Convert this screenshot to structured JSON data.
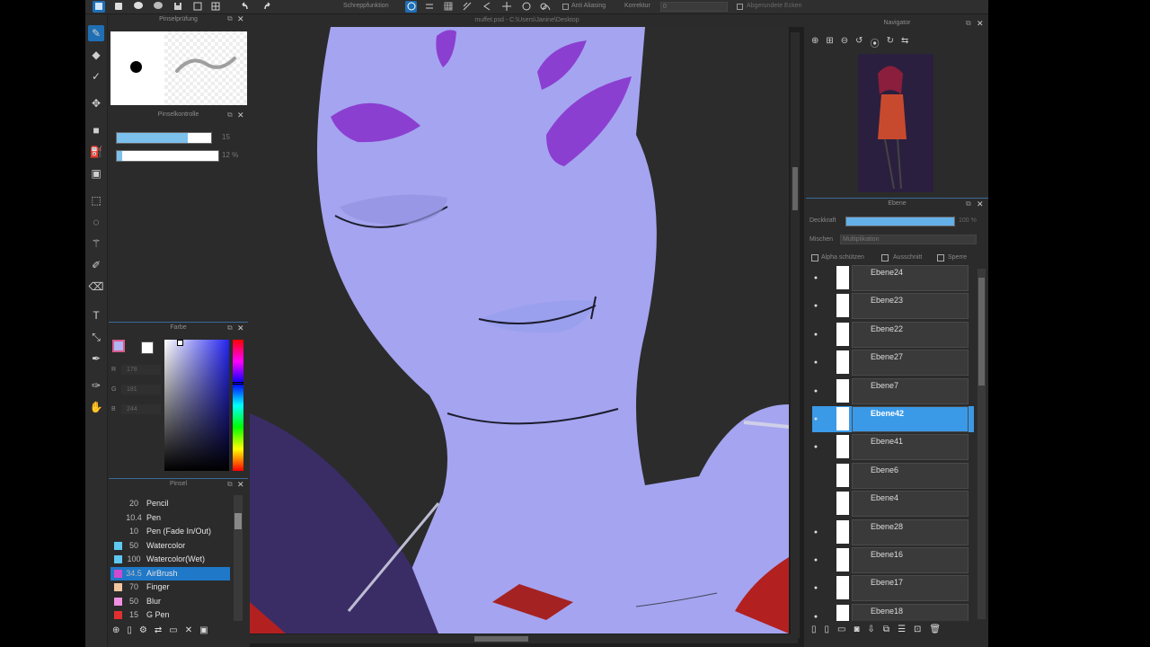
{
  "topbar": {
    "menu_label": "Schreppfunktion",
    "anti_alias_label": "Anti Aliasing",
    "korrektur_label": "Korrektur",
    "korrektur_value": "0",
    "right_label": "Abgerundete Ecken"
  },
  "document": {
    "title": "muffet.psd - C:\\Users\\Janine\\Desktop"
  },
  "brush_preview": {
    "title": "Pinselprüfung"
  },
  "brush_control": {
    "title": "Pinselkontrolle",
    "size_value": "15",
    "opacity_value": "12 %",
    "size_fill": 0.75,
    "opacity_fill": 0.05
  },
  "color": {
    "title": "Farbe",
    "r_label": "R",
    "r_value": "178",
    "g_label": "G",
    "g_value": "181",
    "b_label": "B",
    "b_value": "244",
    "current_color": "#b2b5f4"
  },
  "brushes": {
    "title": "Pinsel",
    "items": [
      {
        "size": "20",
        "name": "Pencil",
        "color": "#2b2b2b"
      },
      {
        "size": "10.4",
        "name": "Pen",
        "color": "#2b2b2b"
      },
      {
        "size": "10",
        "name": "Pen (Fade In/Out)",
        "color": "#2b2b2b"
      },
      {
        "size": "50",
        "name": "Watercolor",
        "color": "#5ec8f0"
      },
      {
        "size": "100",
        "name": "Watercolor(Wet)",
        "color": "#5ec8f0"
      },
      {
        "size": "34.5",
        "name": "AirBrush",
        "color": "#d04ad0"
      },
      {
        "size": "70",
        "name": "Finger",
        "color": "#f2c7a0"
      },
      {
        "size": "50",
        "name": "Blur",
        "color": "#f090e0"
      },
      {
        "size": "15",
        "name": "G Pen",
        "color": "#e03030"
      }
    ]
  },
  "navigator": {
    "title": "Navigator"
  },
  "layers": {
    "title": "Ebene",
    "opacity_label": "Deckkraft",
    "opacity_value": "100 %",
    "opacity_fill": 1.0,
    "blend_label": "Mischen",
    "blend_value": "Multiplikation",
    "protect_alpha_label": "Alpha schützen",
    "clipping_label": "Ausschnitt",
    "lock_label": "Sperre",
    "items": [
      {
        "name": "Ebene24",
        "visible": true
      },
      {
        "name": "Ebene23",
        "visible": true
      },
      {
        "name": "Ebene22",
        "visible": true
      },
      {
        "name": "Ebene27",
        "visible": true
      },
      {
        "name": "Ebene7",
        "visible": true
      },
      {
        "name": "Ebene42",
        "visible": true,
        "selected": true
      },
      {
        "name": "Ebene41",
        "visible": true
      },
      {
        "name": "Ebene6",
        "visible": false
      },
      {
        "name": "Ebene4",
        "visible": false
      },
      {
        "name": "Ebene28",
        "visible": true
      },
      {
        "name": "Ebene16",
        "visible": true
      },
      {
        "name": "Ebene17",
        "visible": true
      },
      {
        "name": "Ebene18",
        "visible": true
      }
    ]
  }
}
